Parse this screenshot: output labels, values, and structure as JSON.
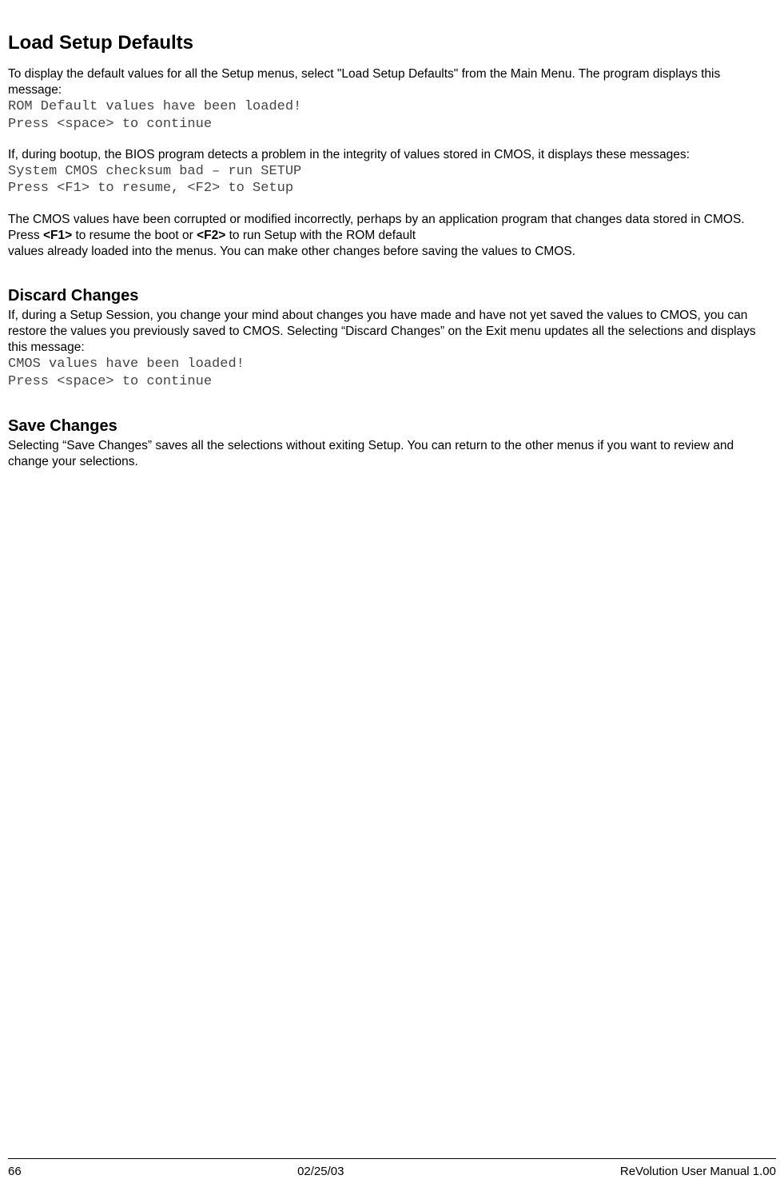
{
  "h1": "Load Setup Defaults",
  "p1": "To display the default values for all the Setup menus, select \"Load Setup Defaults\" from the Main Menu. The program displays this message:",
  "code1a": "ROM Default values have been loaded!",
  "code1b": "Press <space> to continue",
  "p2": "If, during bootup, the BIOS program detects a problem in the integrity of values stored in CMOS, it displays these messages:",
  "code2a": "System CMOS checksum bad – run SETUP",
  "code2b": "Press <F1> to resume, <F2> to Setup",
  "p3_1": "The CMOS values have been corrupted or modified incorrectly, perhaps by an application program that changes data stored in CMOS. Press ",
  "p3_b1": "<F1>",
  "p3_2": " to resume the boot or ",
  "p3_b2": "<F2>",
  "p3_3": " to run Setup with the ROM default",
  "p3_4": "values already loaded into the menus. You can make other changes before saving the values to CMOS.",
  "h2a": "Discard Changes",
  "p4": "If, during a Setup Session, you change your mind about changes you have made and have not yet saved the values to CMOS, you can restore the values you previously saved to CMOS. Selecting “Discard Changes” on the Exit menu updates all the selections and displays this message:",
  "code3a": "CMOS values have been loaded!",
  "code3b": "Press <space> to continue",
  "h2b": "Save Changes",
  "p5": "Selecting “Save Changes” saves all the selections without exiting Setup. You can return to the other menus if you want to review and change your selections.",
  "footer": {
    "page": "66",
    "date": "02/25/03",
    "title": "ReVolution User Manual 1.00"
  }
}
